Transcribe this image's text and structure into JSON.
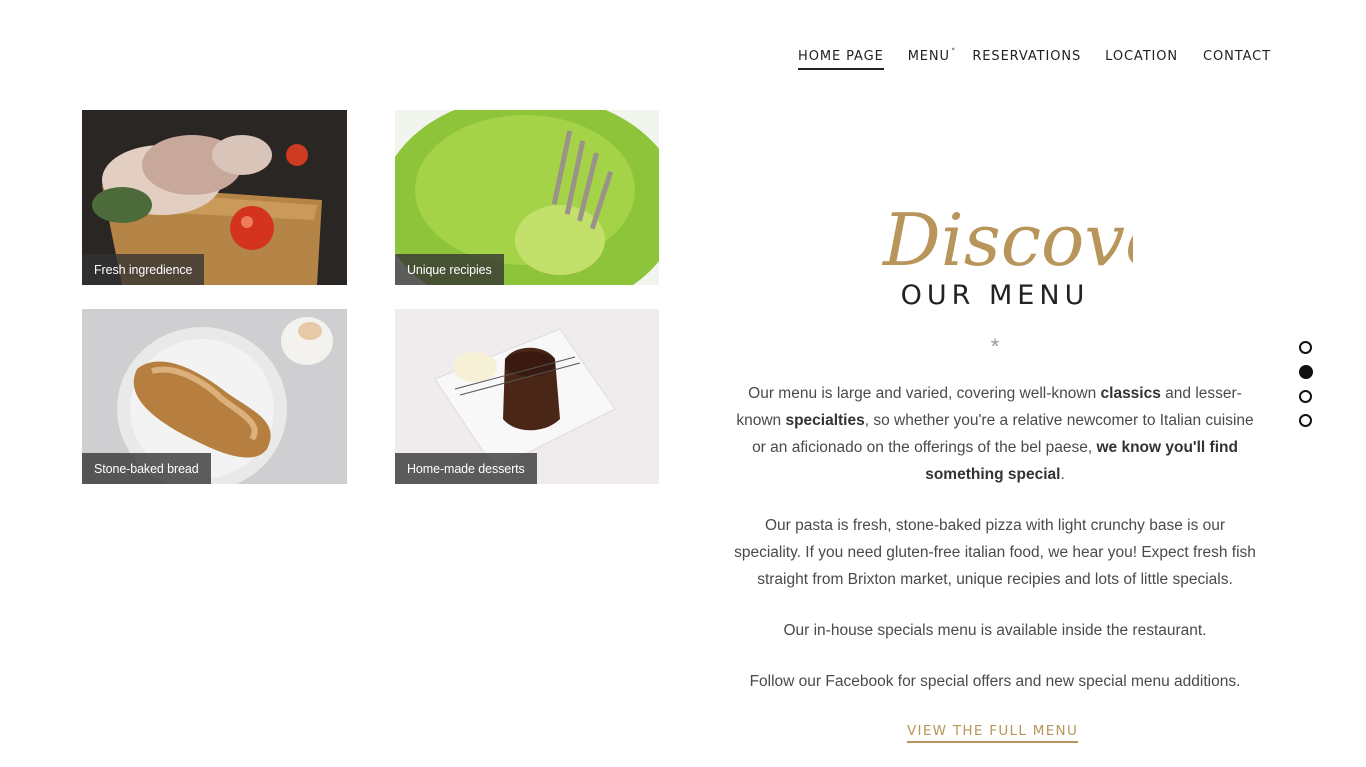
{
  "nav": {
    "items": [
      {
        "label": "HOME PAGE"
      },
      {
        "label": "MENU"
      },
      {
        "label": "RESERVATIONS"
      },
      {
        "label": "LOCATION"
      },
      {
        "label": "CONTACT"
      }
    ]
  },
  "gallery": {
    "tiles": [
      {
        "caption": "Fresh ingredience"
      },
      {
        "caption": "Unique recipies"
      },
      {
        "caption": "Stone-baked bread"
      },
      {
        "caption": "Home-made desserts"
      }
    ]
  },
  "intro": {
    "script_title": "Discover",
    "heading": "OUR MENU",
    "star": "*"
  },
  "copy": {
    "p1_a": "Our menu is large and varied, covering well-known ",
    "p1_b": "classics",
    "p1_c": " and lesser-known ",
    "p1_d": "specialties",
    "p1_e": ", so whether you're a relative newcomer to Italian cuisine or an aficionado on the offerings of the bel paese, ",
    "p1_f": "we know you'll find something special",
    "p1_g": ".",
    "p2": "Our pasta is fresh, stone-baked pizza with light crunchy base is our speciality. If you need gluten-free italian food, we hear you! Expect fresh fish straight from Brixton market, unique recipies and lots of little specials.",
    "p3": "Our in-house specials menu is available inside the restaurant.",
    "p4": "Follow our Facebook for special offers and new special menu additions."
  },
  "cta": {
    "label": "VIEW THE FULL MENU"
  },
  "colors": {
    "accent": "#b8955a",
    "text": "#4a4a4a",
    "caption_bg": "#323232"
  }
}
